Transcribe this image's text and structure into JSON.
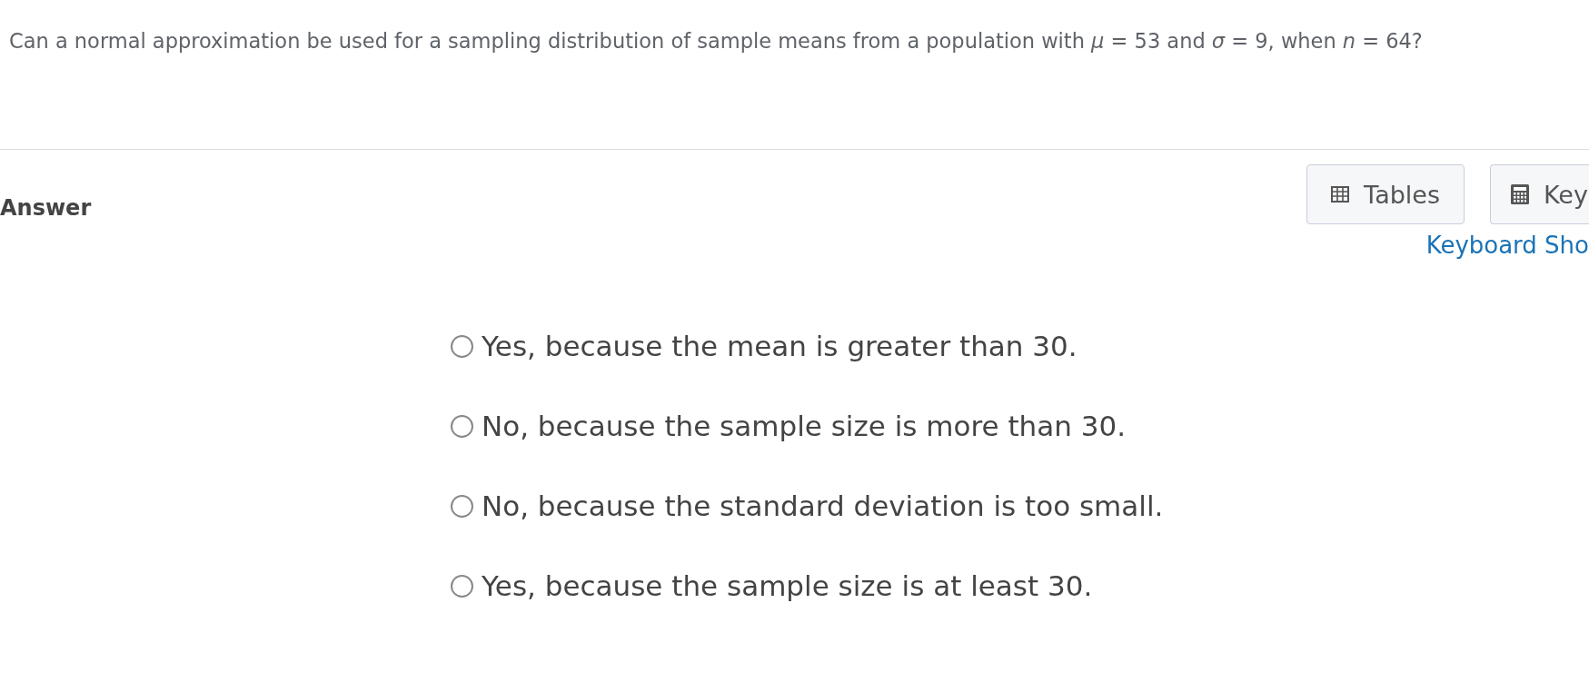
{
  "question": {
    "text": "Can a normal approximation be used for a sampling distribution of sample means from a population with *μ* = 53 and *σ* = 9, when *n* = 64?"
  },
  "answer": {
    "label": "Answer"
  },
  "tools": [
    {
      "kind": "table",
      "label": "Tables"
    },
    {
      "kind": "calculator",
      "label": "Key"
    }
  ],
  "shortcuts_link": "Keyboard Sho",
  "options": [
    {
      "text": "Yes, because the mean is greater than 30.",
      "selected": false
    },
    {
      "text": "No, because the sample size is more than 30.",
      "selected": false
    },
    {
      "text": "No, because the standard deviation is too small.",
      "selected": false
    },
    {
      "text": "Yes, because the sample size is at least 30.",
      "selected": false
    }
  ]
}
